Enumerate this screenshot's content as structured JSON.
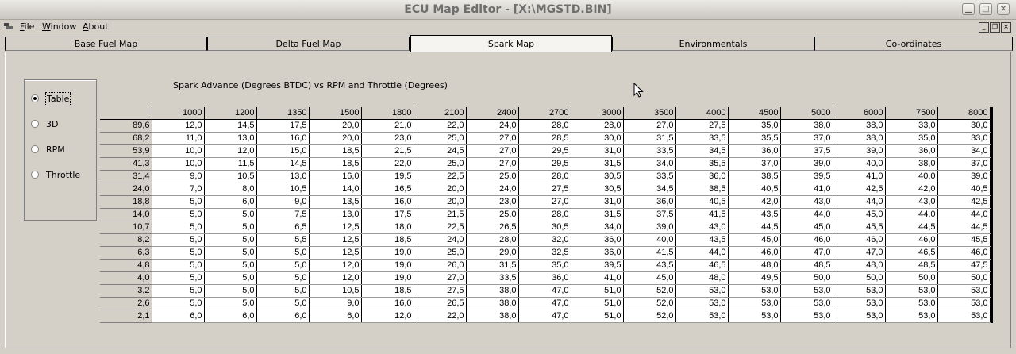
{
  "window": {
    "title": "ECU Map Editor - [X:\\MGSTD.BIN]"
  },
  "menu": {
    "items": [
      {
        "pre": "",
        "u": "F",
        "post": "ile"
      },
      {
        "pre": "",
        "u": "W",
        "post": "indow"
      },
      {
        "pre": "",
        "u": "A",
        "post": "bout"
      }
    ]
  },
  "tabs": [
    "Base Fuel Map",
    "Delta Fuel Map",
    "Spark Map",
    "Environmentals",
    "Co-ordinates"
  ],
  "active_tab": "Spark Map",
  "view_options": [
    "Table",
    "3D",
    "RPM",
    "Throttle"
  ],
  "selected_view": "Table",
  "table": {
    "caption": "Spark Advance (Degrees BTDC) vs RPM and Throttle (Degrees)",
    "rpm": [
      "1000",
      "1200",
      "1350",
      "1500",
      "1800",
      "2100",
      "2400",
      "2700",
      "3000",
      "3500",
      "4000",
      "4500",
      "5000",
      "6000",
      "7500",
      "8000"
    ],
    "throttle": [
      "89,6",
      "68,2",
      "53,9",
      "41,3",
      "31,4",
      "24,0",
      "18,8",
      "14,0",
      "10,7",
      "8,2",
      "6,3",
      "4,8",
      "4,0",
      "3,2",
      "2,6",
      "2,1"
    ],
    "rows": [
      [
        "12,0",
        "14,5",
        "17,5",
        "20,0",
        "21,0",
        "22,0",
        "24,0",
        "28,0",
        "28,0",
        "27,0",
        "27,5",
        "35,0",
        "38,0",
        "38,0",
        "33,0",
        "30,0"
      ],
      [
        "11,0",
        "13,0",
        "16,0",
        "20,0",
        "23,0",
        "25,0",
        "27,0",
        "28,5",
        "30,0",
        "31,5",
        "33,5",
        "35,5",
        "37,0",
        "38,0",
        "35,0",
        "33,0"
      ],
      [
        "10,0",
        "12,0",
        "15,0",
        "18,5",
        "21,5",
        "24,5",
        "27,0",
        "29,5",
        "31,0",
        "33,5",
        "34,5",
        "36,0",
        "37,5",
        "39,0",
        "36,0",
        "34,0"
      ],
      [
        "10,0",
        "11,5",
        "14,5",
        "18,5",
        "22,0",
        "25,0",
        "27,0",
        "29,5",
        "31,5",
        "34,0",
        "35,5",
        "37,0",
        "39,0",
        "40,0",
        "38,0",
        "37,0"
      ],
      [
        "9,0",
        "10,5",
        "13,0",
        "16,0",
        "19,5",
        "22,5",
        "25,0",
        "28,0",
        "30,5",
        "33,5",
        "36,0",
        "38,5",
        "39,5",
        "41,0",
        "40,0",
        "39,0"
      ],
      [
        "7,0",
        "8,0",
        "10,5",
        "14,0",
        "16,5",
        "20,0",
        "24,0",
        "27,5",
        "30,5",
        "34,5",
        "38,5",
        "40,5",
        "41,0",
        "42,5",
        "42,0",
        "40,5"
      ],
      [
        "5,0",
        "6,0",
        "9,0",
        "13,5",
        "16,0",
        "20,0",
        "23,0",
        "27,0",
        "31,0",
        "36,0",
        "40,5",
        "42,0",
        "43,0",
        "44,0",
        "43,0",
        "42,5"
      ],
      [
        "5,0",
        "5,0",
        "7,5",
        "13,0",
        "17,5",
        "21,5",
        "25,0",
        "28,0",
        "31,5",
        "37,5",
        "41,5",
        "43,5",
        "44,0",
        "45,0",
        "44,0",
        "44,0"
      ],
      [
        "5,0",
        "5,0",
        "6,5",
        "12,5",
        "18,0",
        "22,5",
        "26,5",
        "30,5",
        "34,0",
        "39,0",
        "43,0",
        "44,5",
        "45,0",
        "45,5",
        "44,5",
        "44,5"
      ],
      [
        "5,0",
        "5,0",
        "5,5",
        "12,5",
        "18,5",
        "24,0",
        "28,0",
        "32,0",
        "36,0",
        "40,0",
        "43,5",
        "45,0",
        "46,0",
        "46,0",
        "46,0",
        "45,5"
      ],
      [
        "5,0",
        "5,0",
        "5,0",
        "12,5",
        "19,0",
        "25,0",
        "29,0",
        "32,5",
        "36,0",
        "41,5",
        "44,0",
        "46,0",
        "47,0",
        "47,0",
        "46,5",
        "46,0"
      ],
      [
        "5,0",
        "5,0",
        "5,0",
        "12,0",
        "19,0",
        "26,0",
        "31,5",
        "35,0",
        "39,5",
        "43,5",
        "46,5",
        "48,0",
        "48,5",
        "48,0",
        "48,5",
        "47,5"
      ],
      [
        "5,0",
        "5,0",
        "5,0",
        "12,0",
        "19,0",
        "27,0",
        "33,5",
        "36,0",
        "41,0",
        "45,0",
        "48,0",
        "49,5",
        "50,0",
        "50,0",
        "50,0",
        "50,0"
      ],
      [
        "5,0",
        "5,0",
        "5,0",
        "10,5",
        "18,5",
        "27,5",
        "38,0",
        "47,0",
        "51,0",
        "52,0",
        "53,0",
        "53,0",
        "53,0",
        "53,0",
        "53,0",
        "53,0"
      ],
      [
        "5,0",
        "5,0",
        "5,0",
        "9,0",
        "16,0",
        "26,5",
        "38,0",
        "47,0",
        "51,0",
        "52,0",
        "53,0",
        "53,0",
        "53,0",
        "53,0",
        "53,0",
        "53,0"
      ],
      [
        "6,0",
        "6,0",
        "6,0",
        "6,0",
        "12,0",
        "22,0",
        "38,0",
        "47,0",
        "51,0",
        "52,0",
        "53,0",
        "53,0",
        "53,0",
        "53,0",
        "53,0",
        "53,0"
      ]
    ]
  }
}
